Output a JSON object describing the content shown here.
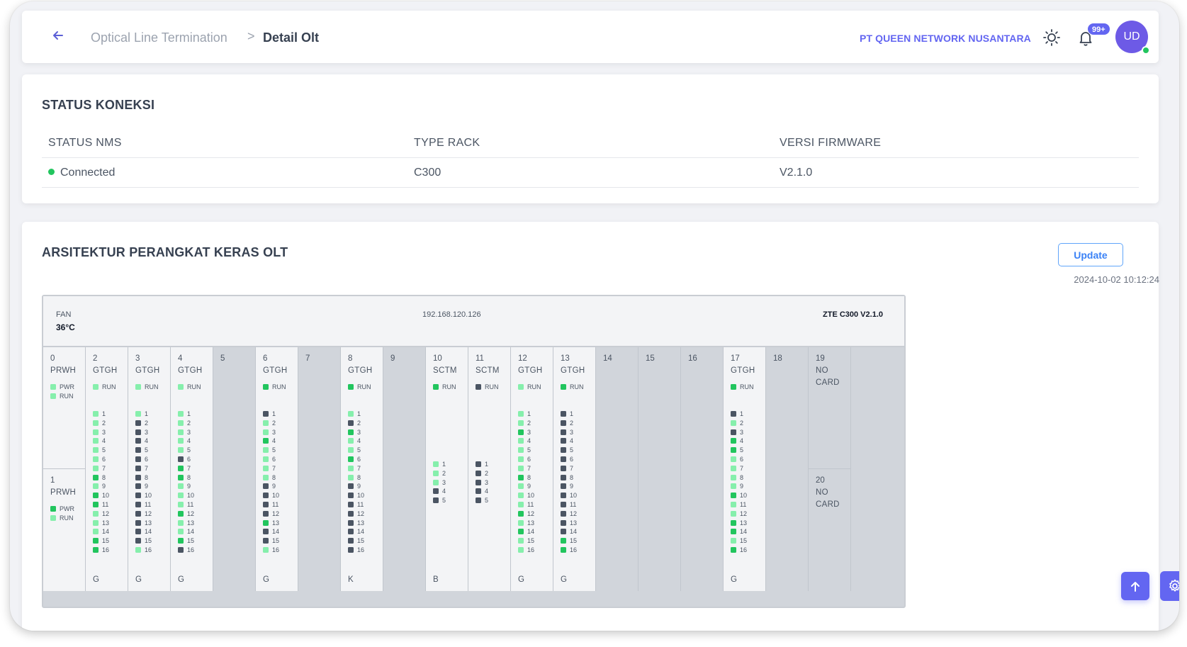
{
  "header": {
    "breadcrumb_parent": "Optical Line Termination",
    "breadcrumb_separator": ">",
    "breadcrumb_current": "Detail Olt",
    "company": "PT QUEEN NETWORK NUSANTARA",
    "notification_count": "99+",
    "avatar_initials": "UD"
  },
  "status": {
    "title": "STATUS KONEKSI",
    "columns": [
      "STATUS NMS",
      "TYPE RACK",
      "VERSI FIRMWARE"
    ],
    "row": {
      "status_nms": "Connected",
      "type_rack": "C300",
      "firmware": "V2.1.0"
    }
  },
  "hardware": {
    "title": "ARSITEKTUR PERANGKAT KERAS OLT",
    "update_label": "Update",
    "updated_at": "2024-10-02 10:12:24",
    "rack": {
      "fan_label": "FAN",
      "fan_temp": "36°C",
      "ip": "192.168.120.126",
      "model": "ZTE C300 V2.1.0"
    },
    "colors": {
      "led_on": "#22c55e",
      "led_light": "#86efac",
      "led_off": "#4b5563"
    },
    "slots": [
      {
        "num": "0",
        "type": "PRWH",
        "kind": "power",
        "half": "top",
        "status": [
          {
            "label": "PWR",
            "s": "lt"
          },
          {
            "label": "RUN",
            "s": "lt"
          }
        ]
      },
      {
        "num": "1",
        "type": "PRWH",
        "kind": "power",
        "half": "bottom",
        "status": [
          {
            "label": "PWR",
            "s": "on"
          },
          {
            "label": "RUN",
            "s": "lt"
          }
        ]
      },
      {
        "num": "2",
        "type": "GTGH",
        "kind": "card",
        "foot": "G",
        "status": [
          {
            "label": "RUN",
            "s": "lt"
          }
        ],
        "ports": [
          "lt",
          "lt",
          "lt",
          "lt",
          "lt",
          "lt",
          "lt",
          "on",
          "lt",
          "on",
          "on",
          "lt",
          "lt",
          "lt",
          "on",
          "on"
        ]
      },
      {
        "num": "3",
        "type": "GTGH",
        "kind": "card",
        "foot": "G",
        "status": [
          {
            "label": "RUN",
            "s": "lt"
          }
        ],
        "ports": [
          "lt",
          "off",
          "off",
          "off",
          "off",
          "off",
          "off",
          "off",
          "off",
          "off",
          "off",
          "off",
          "off",
          "off",
          "off",
          "lt"
        ]
      },
      {
        "num": "4",
        "type": "GTGH",
        "kind": "card",
        "foot": "G",
        "status": [
          {
            "label": "RUN",
            "s": "lt"
          }
        ],
        "ports": [
          "lt",
          "lt",
          "lt",
          "lt",
          "lt",
          "off",
          "on",
          "on",
          "lt",
          "lt",
          "lt",
          "on",
          "lt",
          "lt",
          "on",
          "off"
        ]
      },
      {
        "num": "5",
        "kind": "empty"
      },
      {
        "num": "6",
        "type": "GTGH",
        "kind": "card",
        "foot": "G",
        "status": [
          {
            "label": "RUN",
            "s": "on"
          }
        ],
        "ports": [
          "off",
          "lt",
          "lt",
          "on",
          "lt",
          "lt",
          "lt",
          "lt",
          "off",
          "off",
          "off",
          "off",
          "on",
          "off",
          "off",
          "lt"
        ]
      },
      {
        "num": "7",
        "kind": "empty"
      },
      {
        "num": "8",
        "type": "GTGH",
        "kind": "card",
        "foot": "K",
        "status": [
          {
            "label": "RUN",
            "s": "on"
          }
        ],
        "ports": [
          "lt",
          "off",
          "on",
          "lt",
          "lt",
          "on",
          "lt",
          "lt",
          "off",
          "off",
          "off",
          "off",
          "off",
          "off",
          "off",
          "off"
        ]
      },
      {
        "num": "9",
        "kind": "empty"
      },
      {
        "num": "10",
        "type": "SCTM",
        "kind": "ctrl",
        "foot": "B",
        "status": [
          {
            "label": "RUN",
            "s": "on"
          }
        ],
        "ports": [
          "lt",
          "lt",
          "lt",
          "off",
          "off"
        ]
      },
      {
        "num": "11",
        "type": "SCTM",
        "kind": "ctrl",
        "status": [
          {
            "label": "RUN",
            "s": "off"
          }
        ],
        "ports": [
          "off",
          "off",
          "off",
          "off",
          "off"
        ]
      },
      {
        "num": "12",
        "type": "GTGH",
        "kind": "card",
        "foot": "G",
        "status": [
          {
            "label": "RUN",
            "s": "lt"
          }
        ],
        "ports": [
          "lt",
          "lt",
          "on",
          "lt",
          "lt",
          "lt",
          "lt",
          "on",
          "lt",
          "lt",
          "lt",
          "on",
          "lt",
          "on",
          "lt",
          "lt"
        ]
      },
      {
        "num": "13",
        "type": "GTGH",
        "kind": "card",
        "foot": "G",
        "status": [
          {
            "label": "RUN",
            "s": "on"
          }
        ],
        "ports": [
          "off",
          "off",
          "off",
          "off",
          "off",
          "off",
          "off",
          "off",
          "off",
          "off",
          "off",
          "off",
          "off",
          "off",
          "on",
          "on"
        ]
      },
      {
        "num": "14",
        "kind": "empty"
      },
      {
        "num": "15",
        "kind": "empty"
      },
      {
        "num": "16",
        "kind": "empty"
      },
      {
        "num": "17",
        "type": "GTGH",
        "kind": "card",
        "foot": "G",
        "status": [
          {
            "label": "RUN",
            "s": "on"
          }
        ],
        "ports": [
          "off",
          "lt",
          "off",
          "on",
          "on",
          "lt",
          "lt",
          "lt",
          "lt",
          "on",
          "lt",
          "lt",
          "on",
          "on",
          "lt",
          "on"
        ]
      },
      {
        "num": "18",
        "kind": "empty"
      },
      {
        "num": "19",
        "type": "NO",
        "type2": "CARD",
        "kind": "nocard",
        "half": "top"
      },
      {
        "num": "20",
        "type": "NO",
        "type2": "CARD",
        "kind": "nocard",
        "half": "bottom"
      }
    ]
  }
}
